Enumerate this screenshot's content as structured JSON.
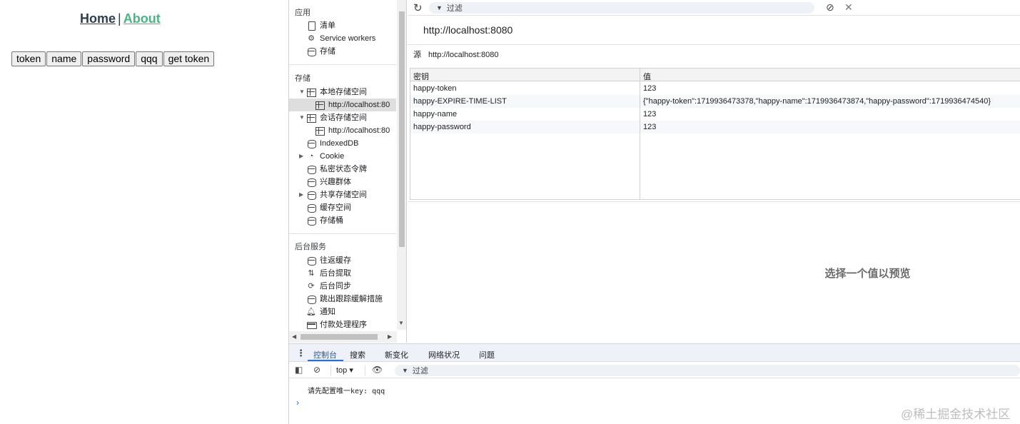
{
  "app": {
    "nav": {
      "home": "Home",
      "separator": "|",
      "about": "About"
    },
    "buttons": [
      "token",
      "name",
      "password",
      "qqq",
      "get token"
    ]
  },
  "devtools": {
    "sidebar": {
      "sections": [
        {
          "title": "应用",
          "items": [
            "清单",
            "Service workers",
            "存储"
          ]
        },
        {
          "title": "存储",
          "items": [
            "本地存储空间",
            "http://localhost:80",
            "会话存储空间",
            "http://localhost:80",
            "IndexedDB",
            "Cookie",
            "私密状态令牌",
            "兴趣群体",
            "共享存储空间",
            "缓存空间",
            "存储桶"
          ]
        },
        {
          "title": "后台服务",
          "items": [
            "往返缓存",
            "后台提取",
            "后台同步",
            "跳出跟踪缓解措施",
            "通知",
            "付款处理程序"
          ]
        }
      ]
    },
    "toolbar": {
      "filter_placeholder": "过滤"
    },
    "origin": {
      "title": "http://localhost:8080",
      "label": "源",
      "value": "http://localhost:8080"
    },
    "table": {
      "headers": [
        "密钥",
        "值"
      ],
      "rows": [
        {
          "key": "happy-token",
          "value": "123"
        },
        {
          "key": "happy-EXPIRE-TIME-LIST",
          "value": "{\"happy-token\":1719936473378,\"happy-name\":1719936473874,\"happy-password\":1719936474540}"
        },
        {
          "key": "happy-name",
          "value": "123"
        },
        {
          "key": "happy-password",
          "value": "123"
        }
      ]
    },
    "preview_text": "选择一个值以预览",
    "drawer": {
      "tabs": [
        "控制台",
        "搜索",
        "新变化",
        "网络状况",
        "问题"
      ],
      "context": "top",
      "filter_placeholder": "过滤",
      "log": "请先配置唯一key: qqq",
      "prompt": "›"
    }
  },
  "watermark": "@稀土掘金技术社区"
}
